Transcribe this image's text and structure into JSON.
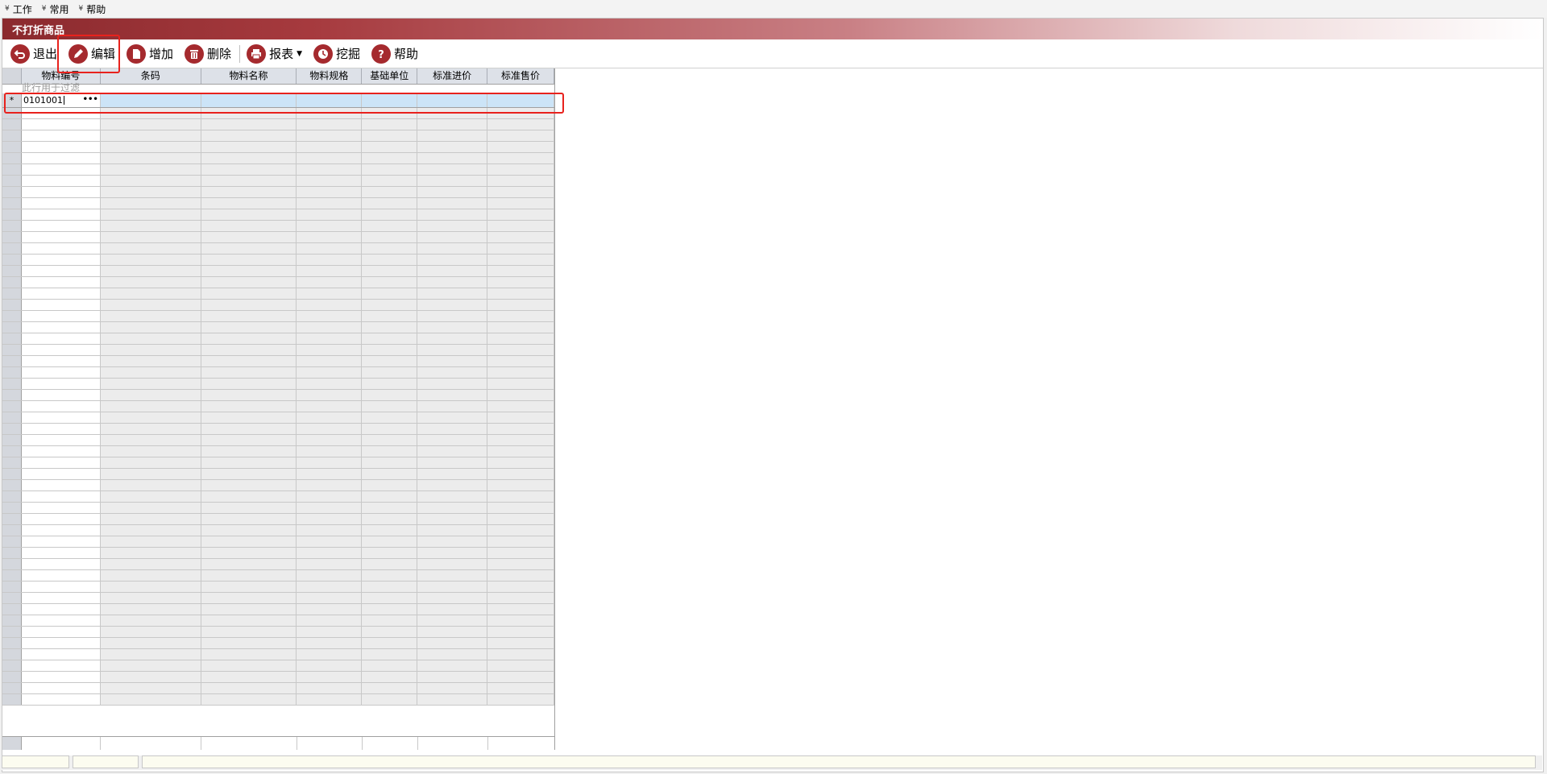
{
  "menu": [
    {
      "label": "工作"
    },
    {
      "label": "常用"
    },
    {
      "label": "帮助"
    }
  ],
  "window": {
    "title": "不打折商品"
  },
  "toolbar": {
    "exit": "退出",
    "edit": "编辑",
    "add": "增加",
    "delete": "删除",
    "report": "报表",
    "mine": "挖掘",
    "help": "帮助"
  },
  "grid": {
    "columns": [
      "物料编号",
      "条码",
      "物料名称",
      "物料规格",
      "基础单位",
      "标准进价",
      "标准售价"
    ],
    "filter_hint": "此行用于过滤",
    "new_row_marker": "*",
    "new_row_value": "0101001",
    "ellipsis": "•••"
  },
  "colors": {
    "brand": "#a52a2e",
    "highlight": "#e8221d",
    "selected_row": "#cce4f7"
  }
}
